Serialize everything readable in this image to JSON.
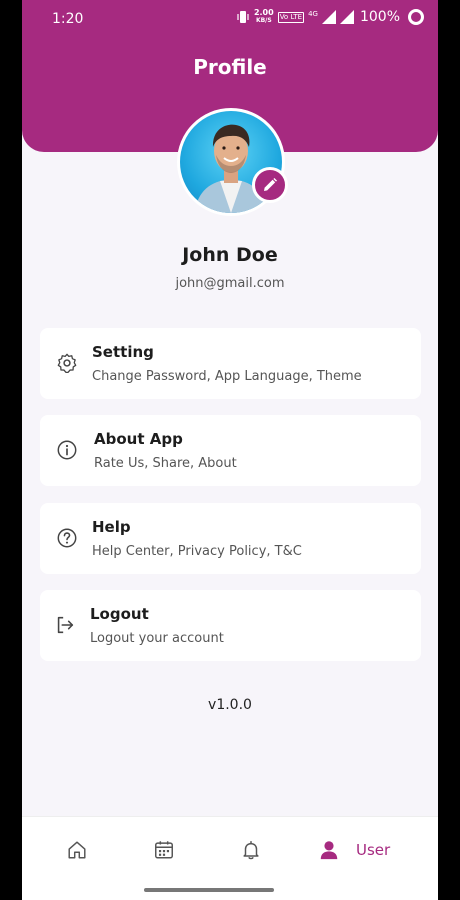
{
  "status_bar": {
    "time": "1:20",
    "net_speed": "2.00",
    "net_unit": "KB/S",
    "volte": "Vo LTE",
    "network": "4G",
    "battery": "100%"
  },
  "header": {
    "title": "Profile"
  },
  "profile": {
    "name": "John Doe",
    "email": "john@gmail.com"
  },
  "menu": [
    {
      "icon": "gear-icon",
      "title": "Setting",
      "subtitle": "Change Password, App Language, Theme"
    },
    {
      "icon": "info-icon",
      "title": "About App",
      "subtitle": "Rate Us, Share, About"
    },
    {
      "icon": "help-icon",
      "title": "Help",
      "subtitle": "Help Center, Privacy Policy, T&C"
    },
    {
      "icon": "logout-icon",
      "title": "Logout",
      "subtitle": "Logout your account"
    }
  ],
  "version": "v1.0.0",
  "bottom_nav": {
    "items": [
      {
        "icon": "home-icon",
        "active": false
      },
      {
        "icon": "calendar-icon",
        "active": false
      },
      {
        "icon": "bell-icon",
        "active": false
      },
      {
        "icon": "user-icon",
        "label": "User",
        "active": true
      }
    ]
  },
  "colors": {
    "primary": "#a62a80",
    "background": "#f7f5fa",
    "card": "#ffffff"
  }
}
